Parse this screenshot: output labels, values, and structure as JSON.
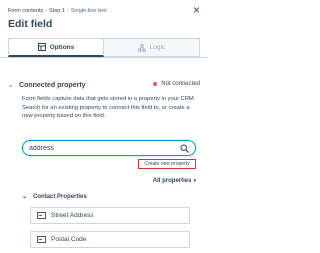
{
  "breadcrumb": {
    "items": [
      "Form contents",
      "Step 1",
      "Single-line text"
    ],
    "separators": [
      "›",
      "›"
    ]
  },
  "panel": {
    "title": "Edit field",
    "close_icon": "close-icon"
  },
  "tabs": [
    {
      "label": "Options",
      "icon": "options-icon",
      "active": true
    },
    {
      "label": "Logic",
      "icon": "logic-icon",
      "active": false
    }
  ],
  "connected_property": {
    "title": "Connected property",
    "status": "Not connected",
    "status_color": "#f2545b",
    "description_1": "Form fields capture data that gets stored in a property in your CRM.",
    "description_2": "Search for an existing property to connect this field to, or create a new property based on this field."
  },
  "search": {
    "value": "address",
    "placeholder": ""
  },
  "create_button": {
    "label": "Create new property"
  },
  "filter": {
    "label": "All properties",
    "caret": "▾"
  },
  "group": {
    "title": "Contact Properties",
    "items": [
      {
        "label": "Street Address",
        "icon": "single-line-field-icon"
      },
      {
        "label": "Postal Code",
        "icon": "single-line-field-icon"
      }
    ]
  },
  "colors": {
    "accent": "#00a4bd",
    "highlight": "#d1372b",
    "text": "#33475b"
  }
}
